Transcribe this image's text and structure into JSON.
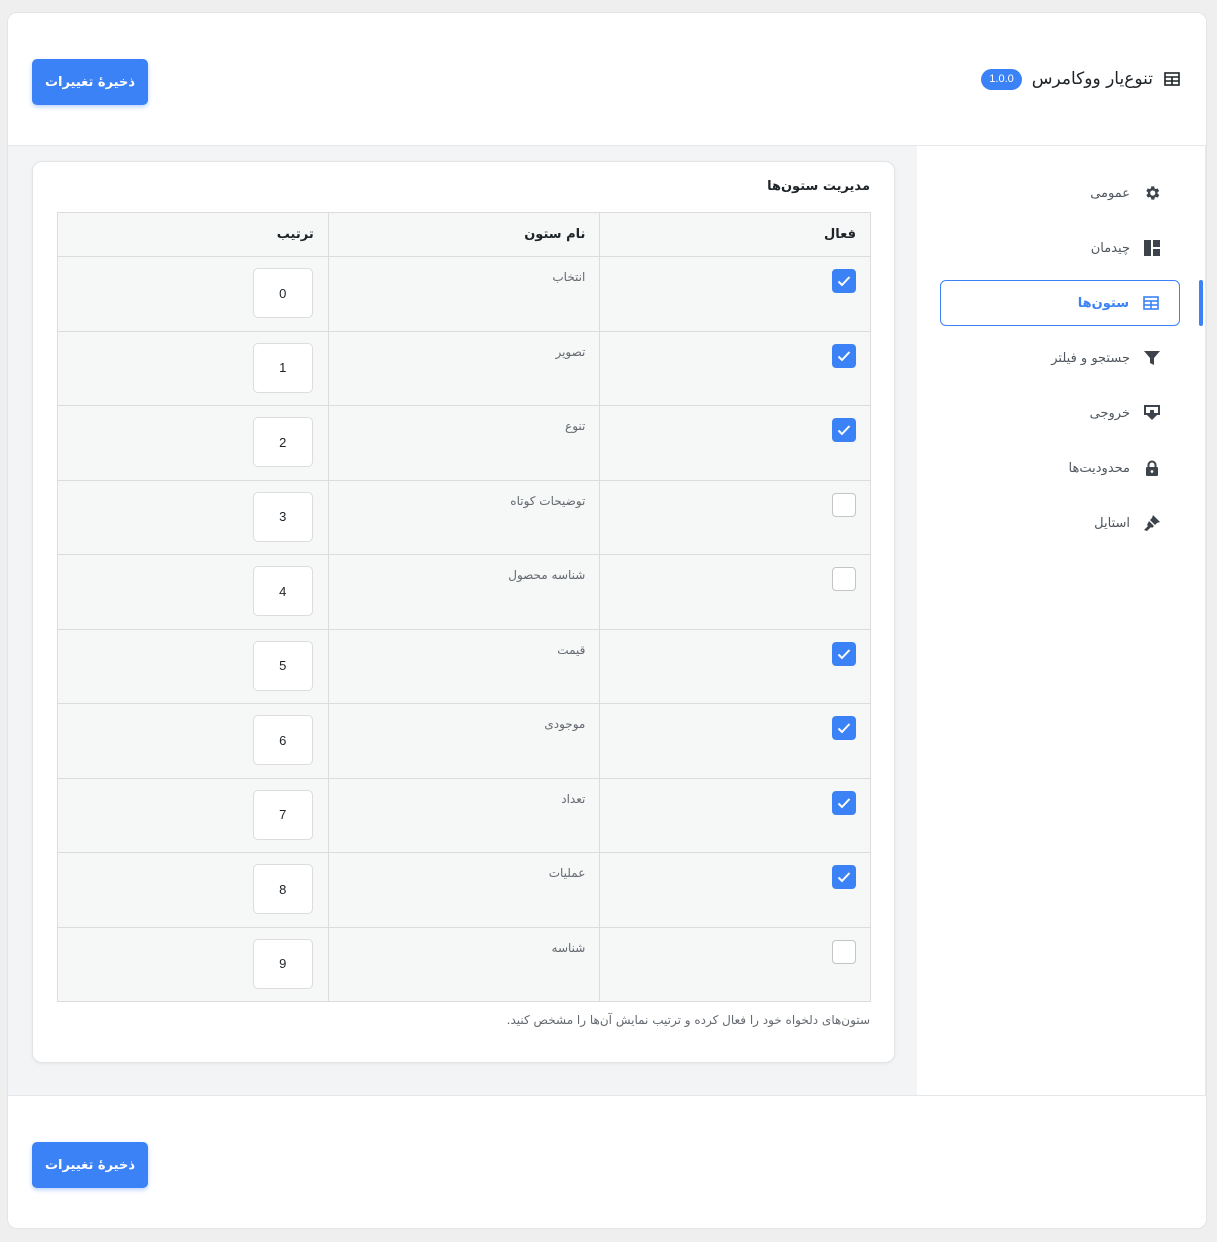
{
  "app": {
    "title": "تنوع‌یار ووکامرس",
    "version": "1.0.0",
    "save_label": "ذخیرهٔ تغییرات"
  },
  "sidebar": {
    "items": [
      {
        "label": "عمومی",
        "icon": "gear-icon"
      },
      {
        "label": "چیدمان",
        "icon": "layout-icon"
      },
      {
        "label": "ستون‌ها",
        "icon": "table-icon",
        "active": true
      },
      {
        "label": "جستجو و فیلتر",
        "icon": "filter-icon"
      },
      {
        "label": "خروجی",
        "icon": "download-icon"
      },
      {
        "label": "محدودیت‌ها",
        "icon": "lock-icon"
      },
      {
        "label": "استایل",
        "icon": "brush-icon"
      }
    ]
  },
  "columns_card": {
    "title": "مدیریت ستون‌ها",
    "headers": {
      "active": "فعال",
      "name": "نام ستون",
      "order": "ترتیب"
    },
    "rows": [
      {
        "name": "انتخاب",
        "active": true,
        "order": "0"
      },
      {
        "name": "تصویر",
        "active": true,
        "order": "1"
      },
      {
        "name": "تنوع",
        "active": true,
        "order": "2"
      },
      {
        "name": "توضیحات کوتاه",
        "active": false,
        "order": "3"
      },
      {
        "name": "شناسه محصول",
        "active": false,
        "order": "4"
      },
      {
        "name": "قیمت",
        "active": true,
        "order": "5"
      },
      {
        "name": "موجودی",
        "active": true,
        "order": "6"
      },
      {
        "name": "تعداد",
        "active": true,
        "order": "7"
      },
      {
        "name": "عملیات",
        "active": true,
        "order": "8"
      },
      {
        "name": "شناسه",
        "active": false,
        "order": "9"
      }
    ],
    "hint": "ستون‌های دلخواه خود را فعال کرده و ترتیب نمایش آن‌ها را مشخص کنید."
  },
  "colors": {
    "accent": "#3b82f6"
  }
}
